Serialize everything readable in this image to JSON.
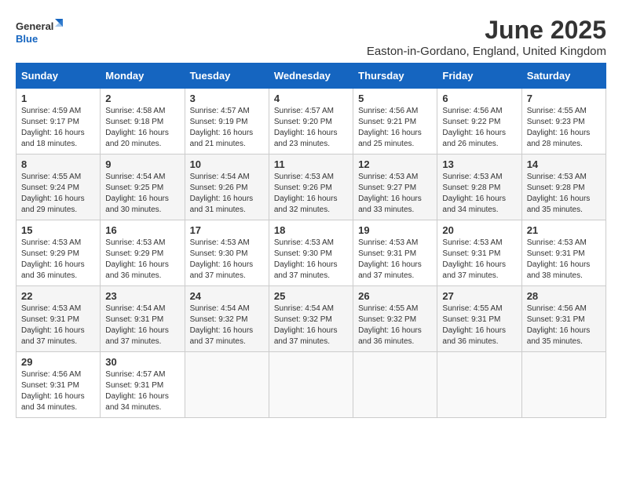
{
  "header": {
    "logo_general": "General",
    "logo_blue": "Blue",
    "title": "June 2025",
    "subtitle": "Easton-in-Gordano, England, United Kingdom"
  },
  "days_of_week": [
    "Sunday",
    "Monday",
    "Tuesday",
    "Wednesday",
    "Thursday",
    "Friday",
    "Saturday"
  ],
  "weeks": [
    [
      {
        "day": "1",
        "info": "Sunrise: 4:59 AM\nSunset: 9:17 PM\nDaylight: 16 hours and 18 minutes."
      },
      {
        "day": "2",
        "info": "Sunrise: 4:58 AM\nSunset: 9:18 PM\nDaylight: 16 hours and 20 minutes."
      },
      {
        "day": "3",
        "info": "Sunrise: 4:57 AM\nSunset: 9:19 PM\nDaylight: 16 hours and 21 minutes."
      },
      {
        "day": "4",
        "info": "Sunrise: 4:57 AM\nSunset: 9:20 PM\nDaylight: 16 hours and 23 minutes."
      },
      {
        "day": "5",
        "info": "Sunrise: 4:56 AM\nSunset: 9:21 PM\nDaylight: 16 hours and 25 minutes."
      },
      {
        "day": "6",
        "info": "Sunrise: 4:56 AM\nSunset: 9:22 PM\nDaylight: 16 hours and 26 minutes."
      },
      {
        "day": "7",
        "info": "Sunrise: 4:55 AM\nSunset: 9:23 PM\nDaylight: 16 hours and 28 minutes."
      }
    ],
    [
      {
        "day": "8",
        "info": "Sunrise: 4:55 AM\nSunset: 9:24 PM\nDaylight: 16 hours and 29 minutes."
      },
      {
        "day": "9",
        "info": "Sunrise: 4:54 AM\nSunset: 9:25 PM\nDaylight: 16 hours and 30 minutes."
      },
      {
        "day": "10",
        "info": "Sunrise: 4:54 AM\nSunset: 9:26 PM\nDaylight: 16 hours and 31 minutes."
      },
      {
        "day": "11",
        "info": "Sunrise: 4:53 AM\nSunset: 9:26 PM\nDaylight: 16 hours and 32 minutes."
      },
      {
        "day": "12",
        "info": "Sunrise: 4:53 AM\nSunset: 9:27 PM\nDaylight: 16 hours and 33 minutes."
      },
      {
        "day": "13",
        "info": "Sunrise: 4:53 AM\nSunset: 9:28 PM\nDaylight: 16 hours and 34 minutes."
      },
      {
        "day": "14",
        "info": "Sunrise: 4:53 AM\nSunset: 9:28 PM\nDaylight: 16 hours and 35 minutes."
      }
    ],
    [
      {
        "day": "15",
        "info": "Sunrise: 4:53 AM\nSunset: 9:29 PM\nDaylight: 16 hours and 36 minutes."
      },
      {
        "day": "16",
        "info": "Sunrise: 4:53 AM\nSunset: 9:29 PM\nDaylight: 16 hours and 36 minutes."
      },
      {
        "day": "17",
        "info": "Sunrise: 4:53 AM\nSunset: 9:30 PM\nDaylight: 16 hours and 37 minutes."
      },
      {
        "day": "18",
        "info": "Sunrise: 4:53 AM\nSunset: 9:30 PM\nDaylight: 16 hours and 37 minutes."
      },
      {
        "day": "19",
        "info": "Sunrise: 4:53 AM\nSunset: 9:31 PM\nDaylight: 16 hours and 37 minutes."
      },
      {
        "day": "20",
        "info": "Sunrise: 4:53 AM\nSunset: 9:31 PM\nDaylight: 16 hours and 37 minutes."
      },
      {
        "day": "21",
        "info": "Sunrise: 4:53 AM\nSunset: 9:31 PM\nDaylight: 16 hours and 38 minutes."
      }
    ],
    [
      {
        "day": "22",
        "info": "Sunrise: 4:53 AM\nSunset: 9:31 PM\nDaylight: 16 hours and 37 minutes."
      },
      {
        "day": "23",
        "info": "Sunrise: 4:54 AM\nSunset: 9:31 PM\nDaylight: 16 hours and 37 minutes."
      },
      {
        "day": "24",
        "info": "Sunrise: 4:54 AM\nSunset: 9:32 PM\nDaylight: 16 hours and 37 minutes."
      },
      {
        "day": "25",
        "info": "Sunrise: 4:54 AM\nSunset: 9:32 PM\nDaylight: 16 hours and 37 minutes."
      },
      {
        "day": "26",
        "info": "Sunrise: 4:55 AM\nSunset: 9:32 PM\nDaylight: 16 hours and 36 minutes."
      },
      {
        "day": "27",
        "info": "Sunrise: 4:55 AM\nSunset: 9:31 PM\nDaylight: 16 hours and 36 minutes."
      },
      {
        "day": "28",
        "info": "Sunrise: 4:56 AM\nSunset: 9:31 PM\nDaylight: 16 hours and 35 minutes."
      }
    ],
    [
      {
        "day": "29",
        "info": "Sunrise: 4:56 AM\nSunset: 9:31 PM\nDaylight: 16 hours and 34 minutes."
      },
      {
        "day": "30",
        "info": "Sunrise: 4:57 AM\nSunset: 9:31 PM\nDaylight: 16 hours and 34 minutes."
      },
      {
        "day": "",
        "info": ""
      },
      {
        "day": "",
        "info": ""
      },
      {
        "day": "",
        "info": ""
      },
      {
        "day": "",
        "info": ""
      },
      {
        "day": "",
        "info": ""
      }
    ]
  ]
}
